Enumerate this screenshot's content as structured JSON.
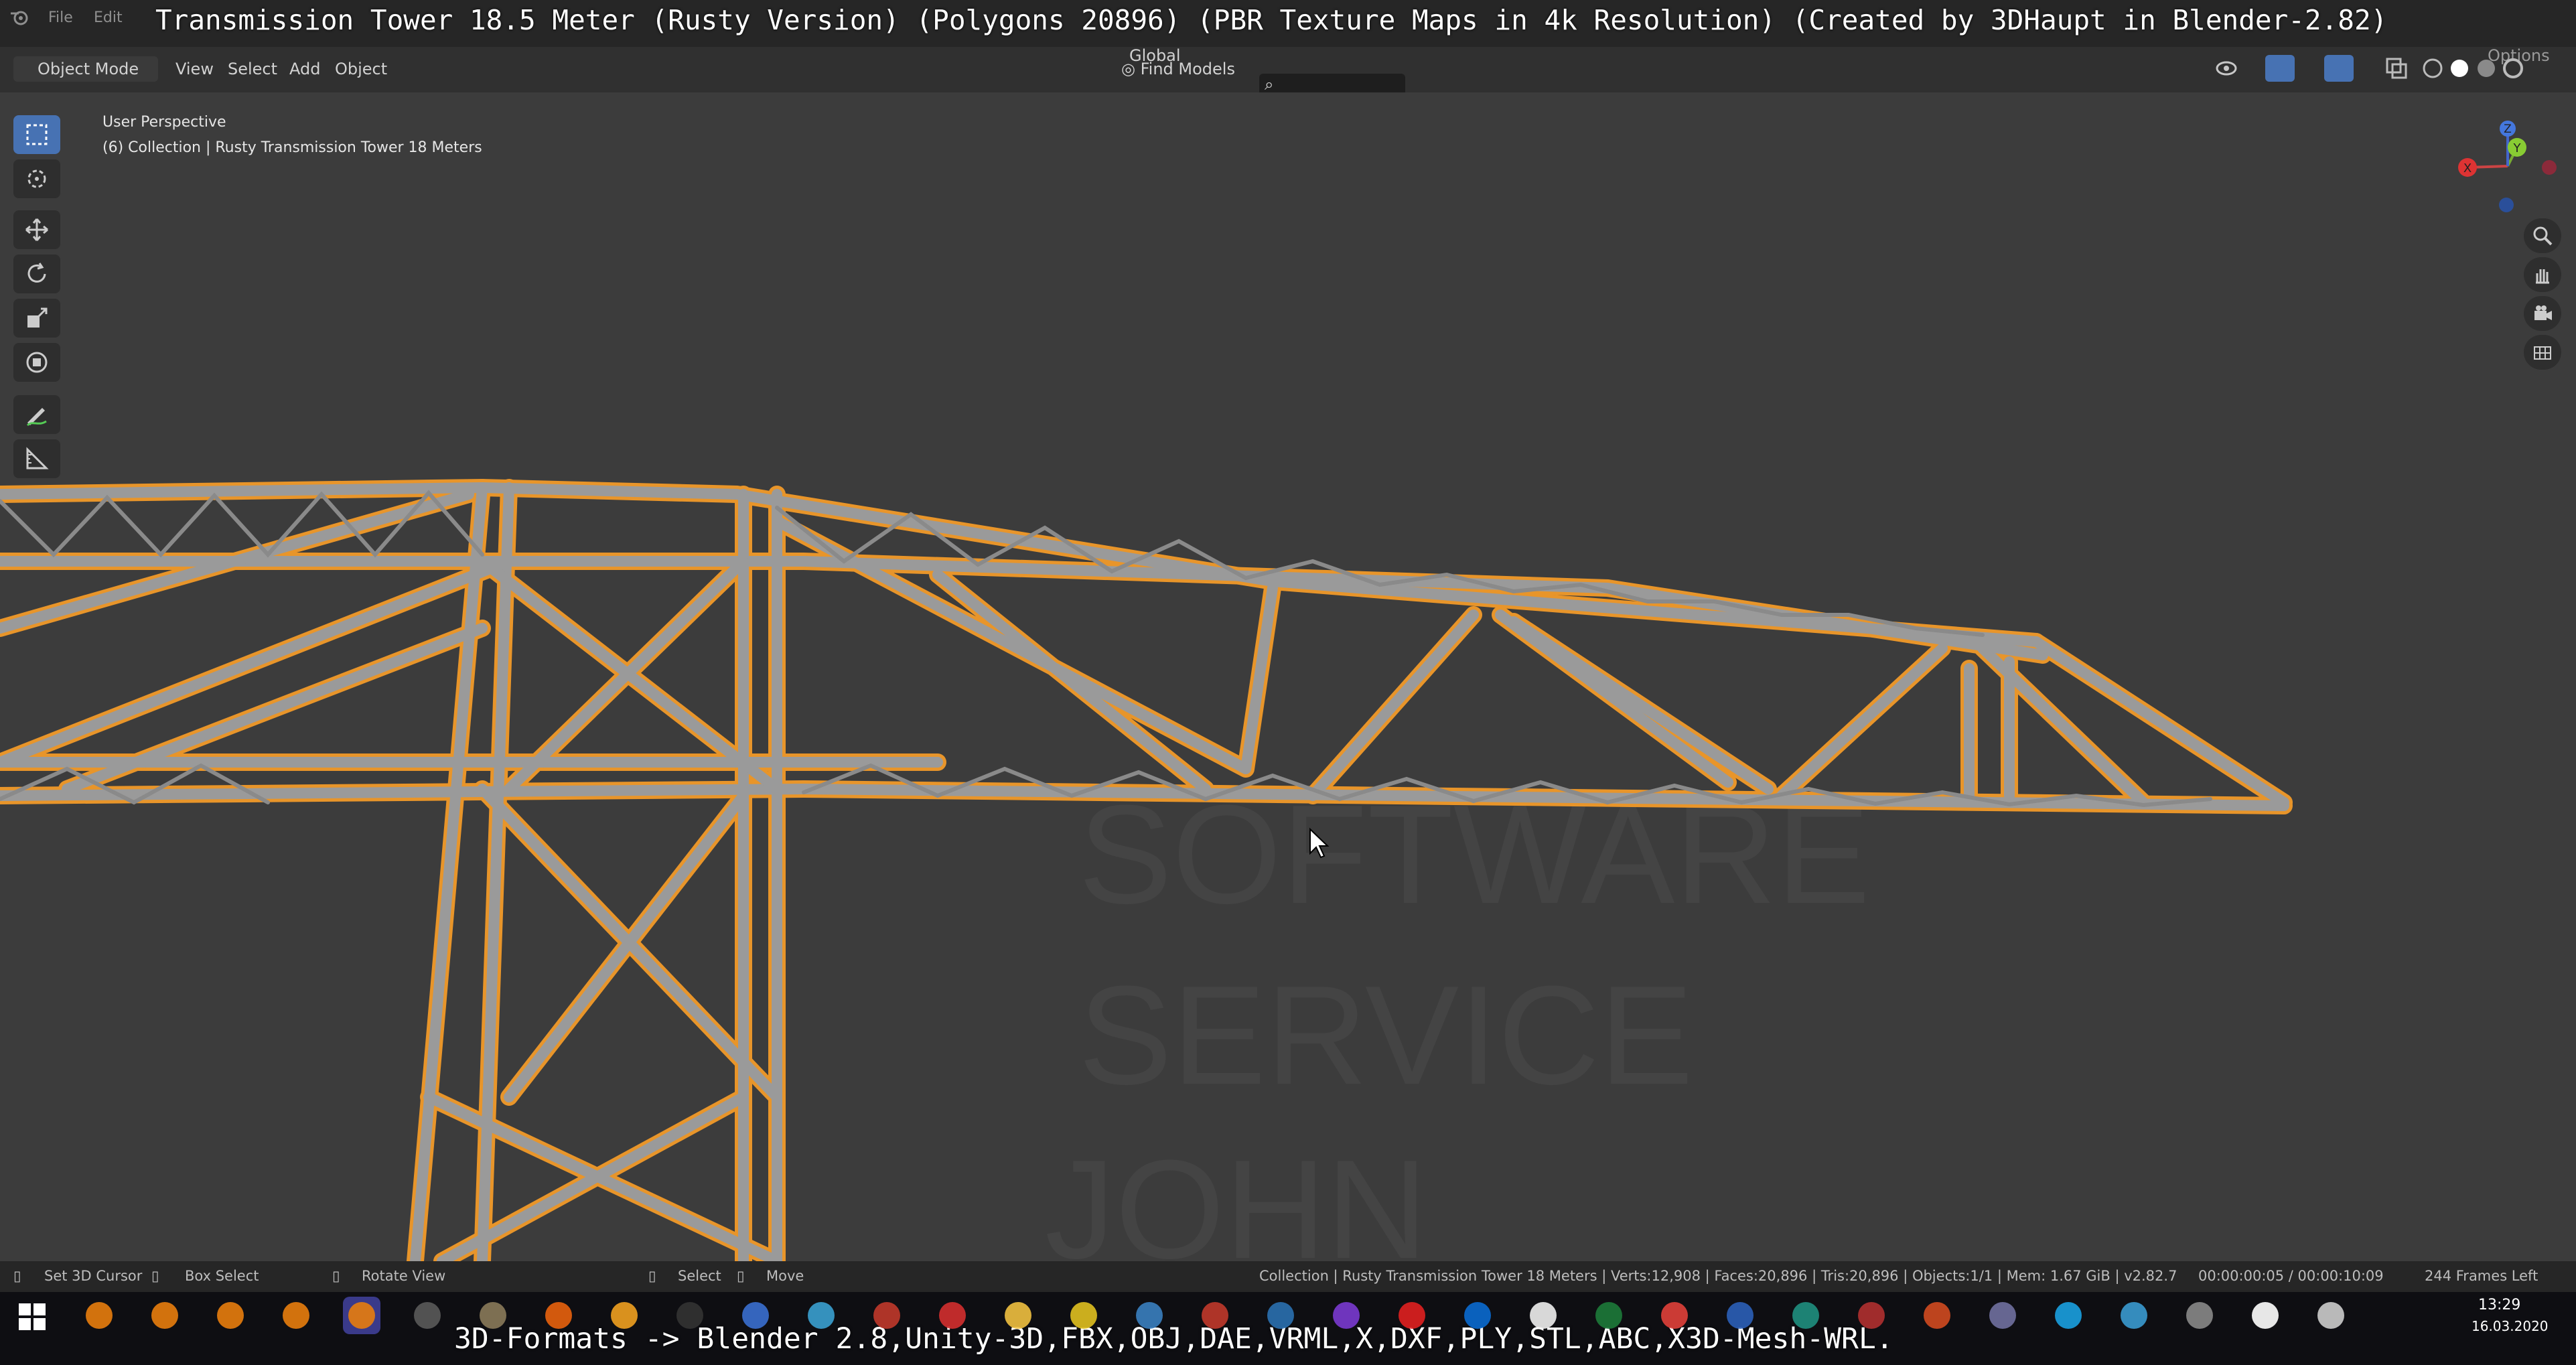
{
  "top_menu": {
    "file": "File",
    "edit": "Edit"
  },
  "title_banner": "Transmission Tower 18.5 Meter (Rusty Version) (Polygons 20896) (PBR Texture Maps in 4k Resolution) (Created by 3DHaupt in Blender-2.82)",
  "header": {
    "mode": "Object Mode",
    "menus": [
      "View",
      "Select",
      "Add",
      "Object"
    ],
    "orientation": "Global",
    "find_models": "Find Models",
    "options": "Options"
  },
  "viewport": {
    "line1": "User Perspective",
    "line2": "(6) Collection | Rusty Transmission Tower 18 Meters",
    "watermark": [
      "SOFTWARE",
      "SERVICE",
      "JOHN"
    ],
    "selection_color": "#e8952a",
    "gizmo": {
      "x": "X",
      "y": "Y",
      "z": "Z"
    }
  },
  "tools": [
    "select-box",
    "cursor",
    "move",
    "rotate",
    "scale",
    "transform",
    "annotate",
    "measure"
  ],
  "status": {
    "set_cursor": "Set 3D Cursor",
    "box_select": "Box Select",
    "rotate_view": "Rotate View",
    "select": "Select",
    "move": "Move",
    "stats": "Collection | Rusty Transmission Tower 18 Meters | Verts:12,908 | Faces:20,896 | Tris:20,896 | Objects:1/1 | Mem: 1.67 GiB | v2.82.7",
    "timecode": "00:00:00:05 / 00:00:10:09",
    "frames_left": "244 Frames Left"
  },
  "bottom_banner": "3D-Formats -> Blender 2.8,Unity-3D,FBX,OBJ,DAE,VRML,X,DXF,PLY,STL,ABC,X3D-Mesh-WRL.",
  "taskbar": {
    "time": "13:29",
    "date": "16.03.2020",
    "apps": [
      "blender-icon",
      "blender-icon",
      "blender-icon",
      "blender-icon",
      "blender-active-icon",
      "app-icon",
      "gimp-icon",
      "firefox-icon",
      "flame-icon",
      "terminal-icon",
      "save-icon",
      "network-icon",
      "bug-icon",
      "pdf-icon",
      "folder-icon",
      "xnview-icon",
      "chart-icon",
      "tool-icon",
      "file-icon",
      "obsidian-icon",
      "opera-icon",
      "outlook-icon",
      "edge-icon",
      "excel-icon",
      "vivaldi-icon",
      "word-icon",
      "publisher-icon",
      "access-icon",
      "powerpoint-icon",
      "misc-icon",
      "skype-icon",
      "pen-icon",
      "plane-icon",
      "unity-icon",
      "steam-icon"
    ]
  }
}
